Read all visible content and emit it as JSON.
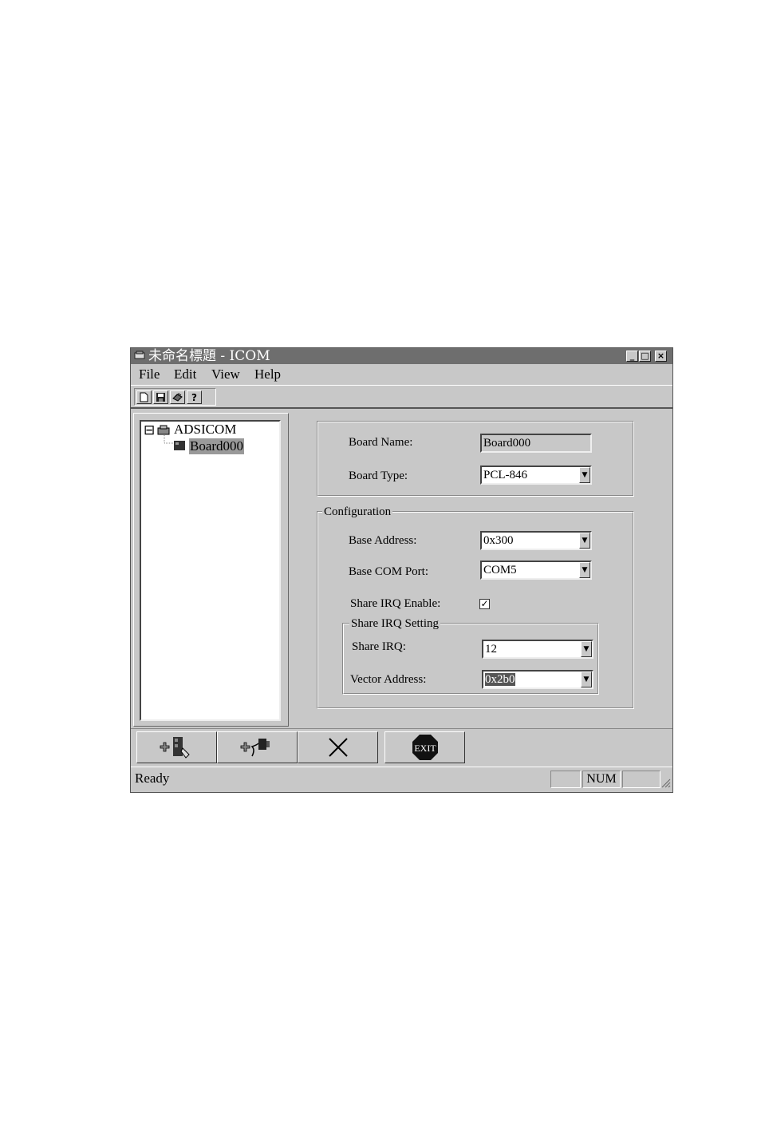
{
  "window": {
    "title": "未命名標題 - ICOM",
    "controls": {
      "minimize": "_",
      "maximize": "□",
      "close": "×"
    }
  },
  "menu": [
    {
      "label": "File"
    },
    {
      "label": "Edit"
    },
    {
      "label": "View"
    },
    {
      "label": "Help"
    }
  ],
  "toolbar": {
    "icons": [
      "new-file-icon",
      "save-icon",
      "print-icon",
      "help-icon"
    ]
  },
  "tree": {
    "root": {
      "label": "ADSICOM",
      "expander": "⊟"
    },
    "child": {
      "label": "Board000",
      "selected": true
    }
  },
  "board": {
    "name_label": "Board Name:",
    "name_value": "Board000",
    "type_label": "Board Type:",
    "type_value": "PCL-846"
  },
  "configuration": {
    "legend": "Configuration",
    "base_address_label": "Base Address:",
    "base_address_value": "0x300",
    "base_com_port_label": "Base COM Port:",
    "base_com_port_value": "COM5",
    "share_irq_enable_label": "Share IRQ Enable:",
    "share_irq_enable_checked": true,
    "share_irq_setting": {
      "legend": "Share IRQ Setting",
      "share_irq_label": "Share IRQ:",
      "share_irq_value": "12",
      "vector_address_label": "Vector Address:",
      "vector_address_value": "0x2b0"
    }
  },
  "bottom_buttons": [
    {
      "icon": "add-board-icon"
    },
    {
      "icon": "add-port-icon"
    },
    {
      "icon": "delete-icon"
    },
    {
      "icon": "exit-icon",
      "text": "EXIT"
    }
  ],
  "status": {
    "text": "Ready",
    "num": "NUM"
  }
}
